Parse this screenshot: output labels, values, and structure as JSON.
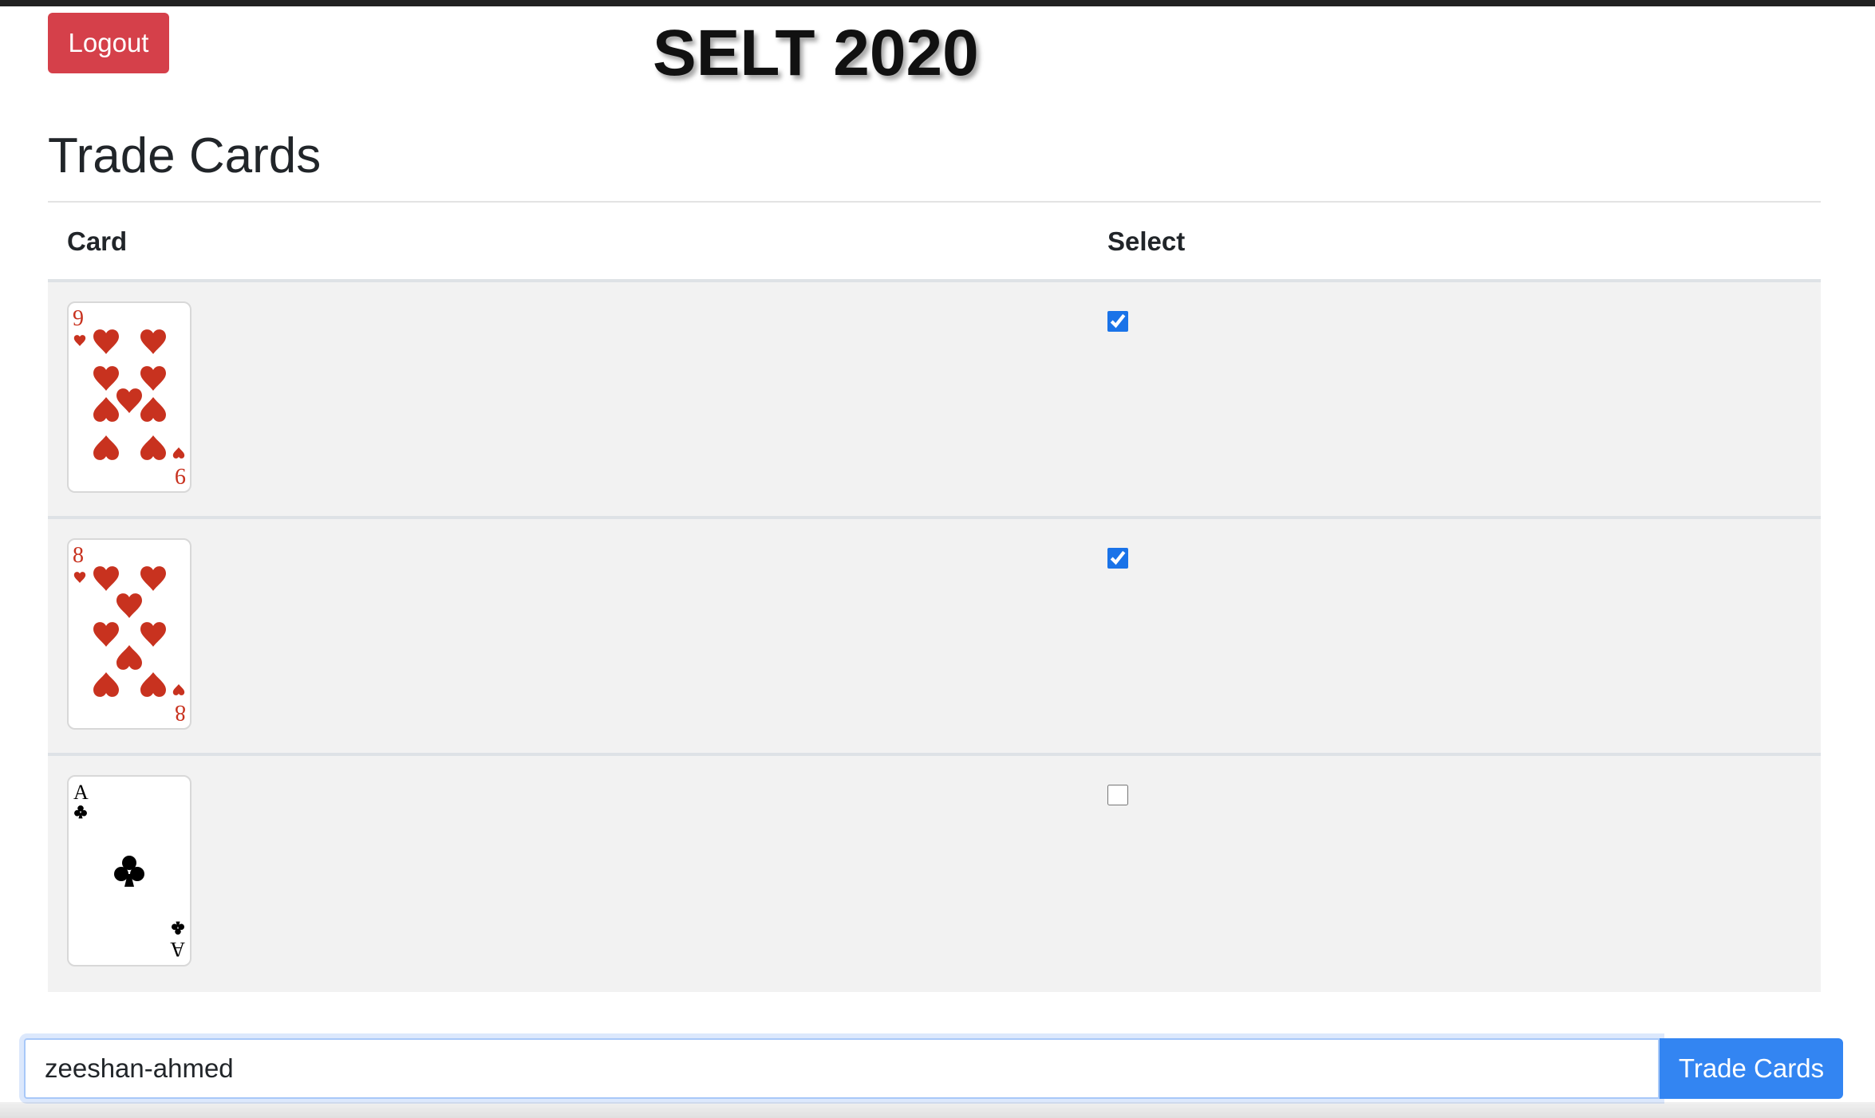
{
  "header": {
    "logout_label": "Logout",
    "app_title": "SELT 2020"
  },
  "main": {
    "section_title": "Trade Cards",
    "table": {
      "columns": [
        "Card",
        "Select"
      ],
      "rows": [
        {
          "card": {
            "rank": "9",
            "suit": "hearts",
            "suit_symbol": "♥"
          },
          "selected": true
        },
        {
          "card": {
            "rank": "8",
            "suit": "hearts",
            "suit_symbol": "♥"
          },
          "selected": true
        },
        {
          "card": {
            "rank": "A",
            "suit": "clubs",
            "suit_symbol": "♣"
          },
          "selected": false
        }
      ]
    },
    "trade_form": {
      "input_value": "zeeshan-ahmed",
      "submit_label": "Trade Cards"
    }
  },
  "colors": {
    "logout_button": "#d5404a",
    "trade_button": "#3385f2",
    "hearts": "#c8321f",
    "clubs": "#000000",
    "row_background": "#f2f2f2"
  },
  "icons": [
    "nine-of-hearts-card",
    "eight-of-hearts-card",
    "ace-of-clubs-card",
    "checkbox-checked",
    "checkbox-unchecked"
  ]
}
